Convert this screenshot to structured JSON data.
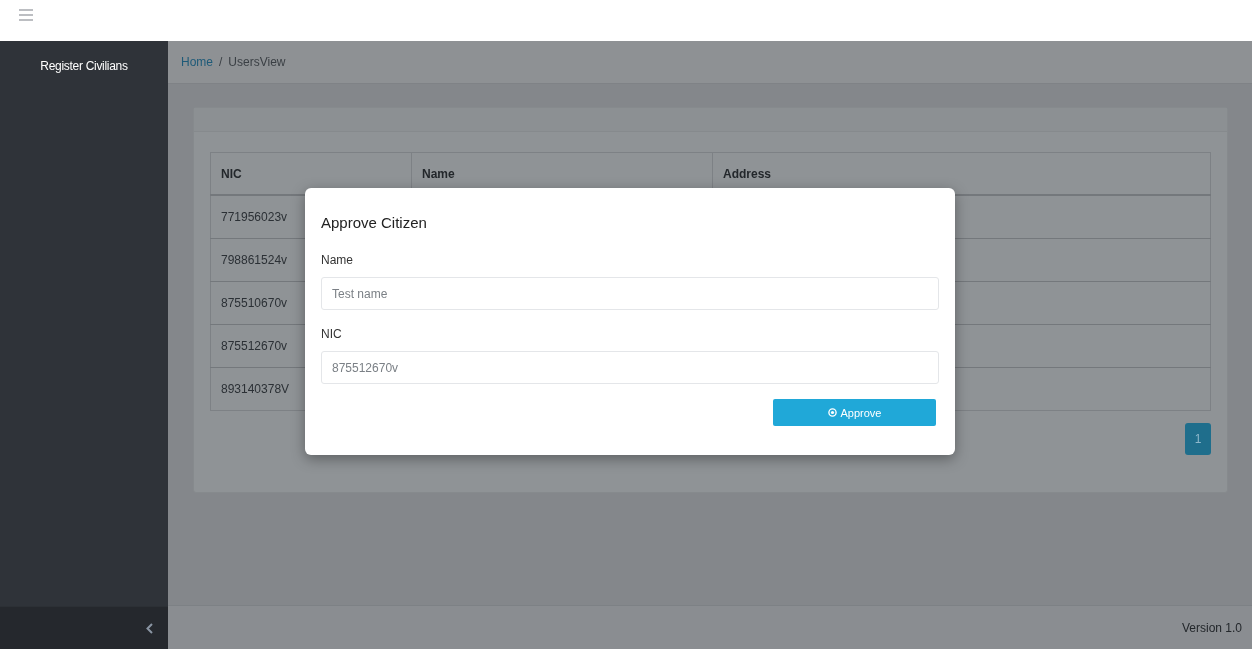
{
  "sidebar": {
    "title": "Register Civilians"
  },
  "breadcrumb": {
    "separator": "/",
    "items": [
      {
        "label": "Home",
        "kind": "link"
      },
      {
        "label": "UsersView",
        "kind": "current"
      }
    ]
  },
  "table": {
    "columns": [
      "NIC",
      "Name",
      "Address"
    ],
    "rows": [
      {
        "nic": "771956023v"
      },
      {
        "nic": "798861524v"
      },
      {
        "nic": "875510670v"
      },
      {
        "nic": "875512670v"
      },
      {
        "nic": "893140378V"
      }
    ]
  },
  "pagination": [
    {
      "label": "1",
      "selected": true
    }
  ],
  "modal": {
    "title": "Approve Citizen",
    "fields": [
      {
        "label": "Name",
        "placeholder": "Test name"
      },
      {
        "label": "NIC",
        "value": "875512670v"
      }
    ],
    "button": "Approve"
  },
  "footer": {
    "version": "Version 1.0"
  }
}
